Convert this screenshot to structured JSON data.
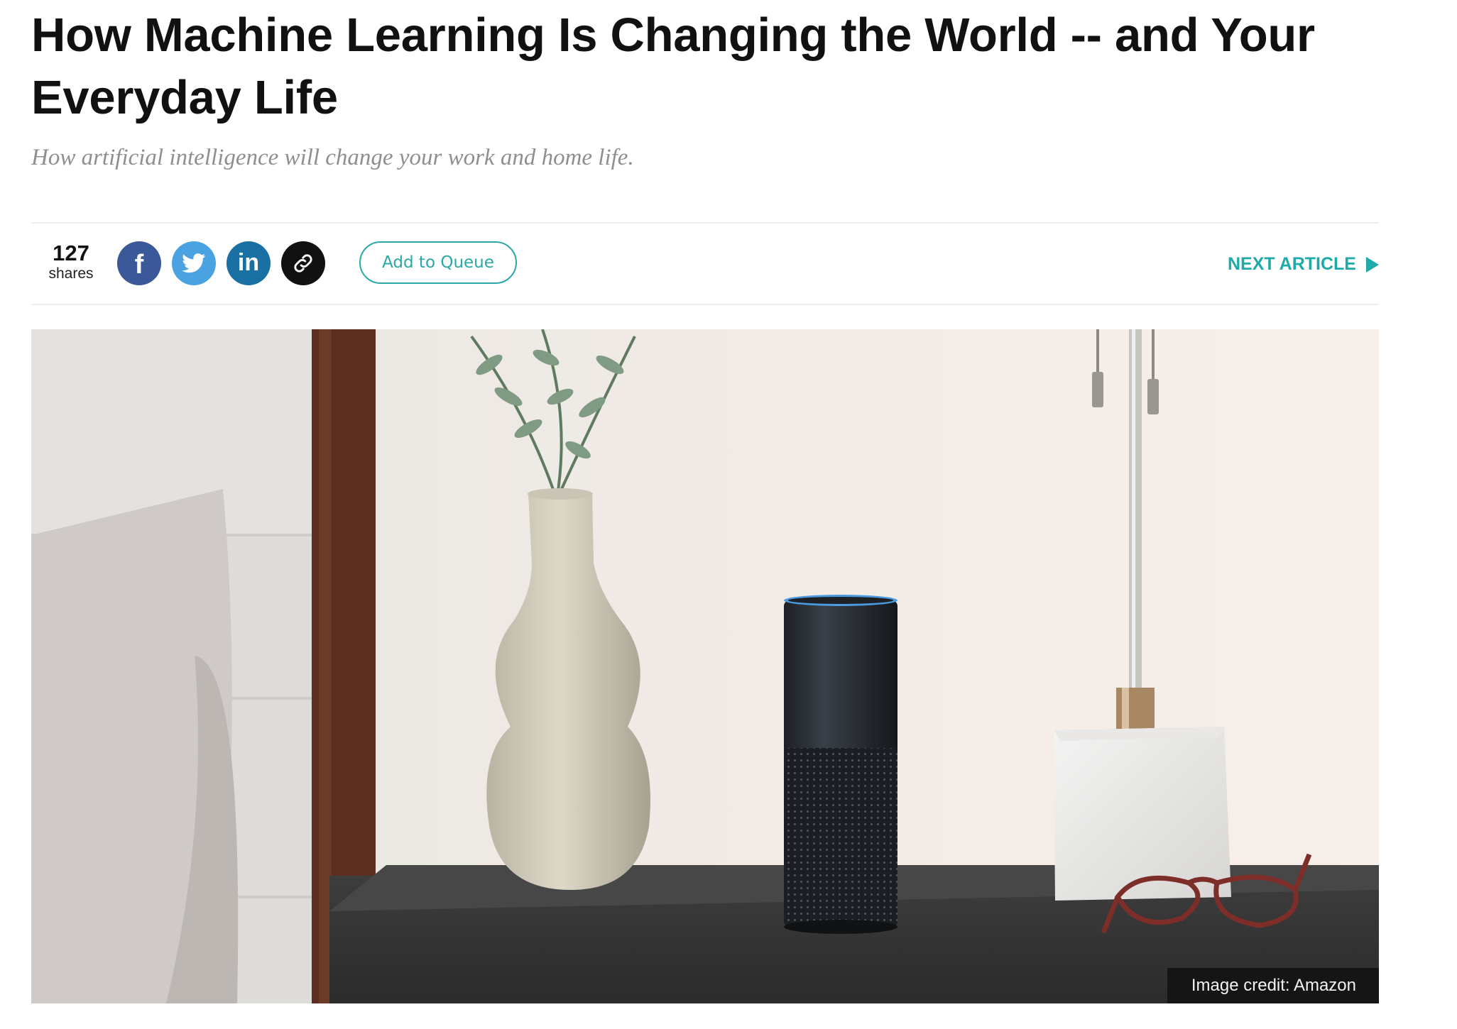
{
  "article": {
    "title": "How Machine Learning Is Changing the World -- and Your Everyday Life",
    "subtitle": "How artificial intelligence will change your work and home life."
  },
  "share_bar": {
    "share_count": "127",
    "share_label": "shares",
    "social_buttons": [
      {
        "name": "facebook",
        "icon": "facebook-icon",
        "color": "#3b5998"
      },
      {
        "name": "twitter",
        "icon": "twitter-icon",
        "color": "#4aa3e0"
      },
      {
        "name": "linkedin",
        "icon": "linkedin-icon",
        "color": "#1a6fa3"
      },
      {
        "name": "copy-link",
        "icon": "link-icon",
        "color": "#111111"
      }
    ],
    "queue_label": "Add to Queue",
    "next_article_label": "NEXT ARTICLE"
  },
  "hero": {
    "image_credit": "Image credit: Amazon"
  },
  "colors": {
    "accent": "#1fa9a9",
    "headline": "#111111",
    "subtitle": "#8f8f8f"
  }
}
